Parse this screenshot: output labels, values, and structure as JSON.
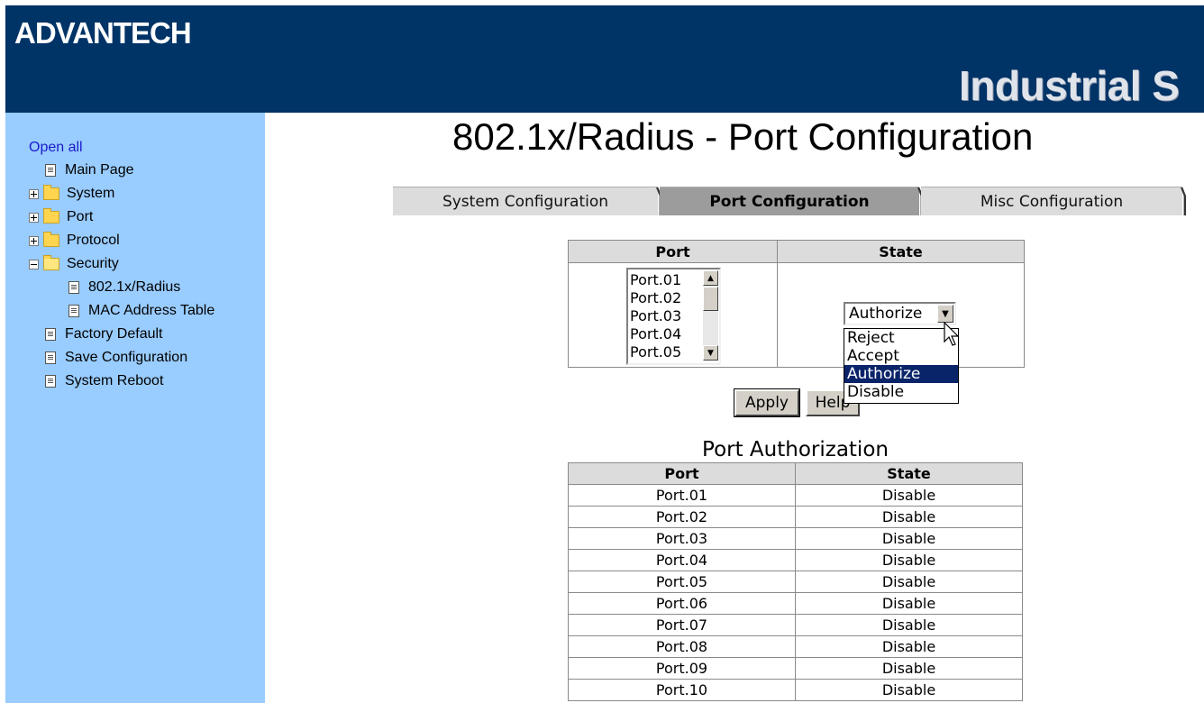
{
  "header": {
    "logo": "ADVANTECH",
    "product": "Industrial S"
  },
  "sidebar": {
    "open_all": "Open all",
    "items": [
      {
        "label": "Main Page",
        "icon": "page-icon"
      },
      {
        "label": "System",
        "icon": "folder-icon",
        "expand": "plus"
      },
      {
        "label": "Port",
        "icon": "folder-icon",
        "expand": "plus"
      },
      {
        "label": "Protocol",
        "icon": "folder-icon",
        "expand": "plus"
      },
      {
        "label": "Security",
        "icon": "folder-open-icon",
        "expand": "minus"
      },
      {
        "label": "802.1x/Radius",
        "icon": "page-icon"
      },
      {
        "label": "MAC Address Table",
        "icon": "page-icon"
      },
      {
        "label": "Factory Default",
        "icon": "page-icon"
      },
      {
        "label": "Save Configuration",
        "icon": "page-icon"
      },
      {
        "label": "System Reboot",
        "icon": "page-icon"
      }
    ]
  },
  "page": {
    "title": "802.1x/Radius - Port Configuration"
  },
  "tabs": [
    {
      "label": "System Configuration",
      "active": false
    },
    {
      "label": "Port Configuration",
      "active": true
    },
    {
      "label": "Misc Configuration",
      "active": false
    }
  ],
  "config": {
    "port_header": "Port",
    "state_header": "State",
    "port_options": [
      "Port.01",
      "Port.02",
      "Port.03",
      "Port.04",
      "Port.05"
    ],
    "state_selected": "Authorize",
    "state_options": [
      "Reject",
      "Accept",
      "Authorize",
      "Disable"
    ]
  },
  "buttons": {
    "apply": "Apply",
    "help": "Help"
  },
  "auth": {
    "title": "Port Authorization",
    "columns": [
      "Port",
      "State"
    ],
    "rows": [
      [
        "Port.01",
        "Disable"
      ],
      [
        "Port.02",
        "Disable"
      ],
      [
        "Port.03",
        "Disable"
      ],
      [
        "Port.04",
        "Disable"
      ],
      [
        "Port.05",
        "Disable"
      ],
      [
        "Port.06",
        "Disable"
      ],
      [
        "Port.07",
        "Disable"
      ],
      [
        "Port.08",
        "Disable"
      ],
      [
        "Port.09",
        "Disable"
      ],
      [
        "Port.10",
        "Disable"
      ]
    ]
  },
  "colors": {
    "header_bg": "#003366",
    "sidebar_bg": "#99ccff",
    "highlight": "#0a246a"
  }
}
